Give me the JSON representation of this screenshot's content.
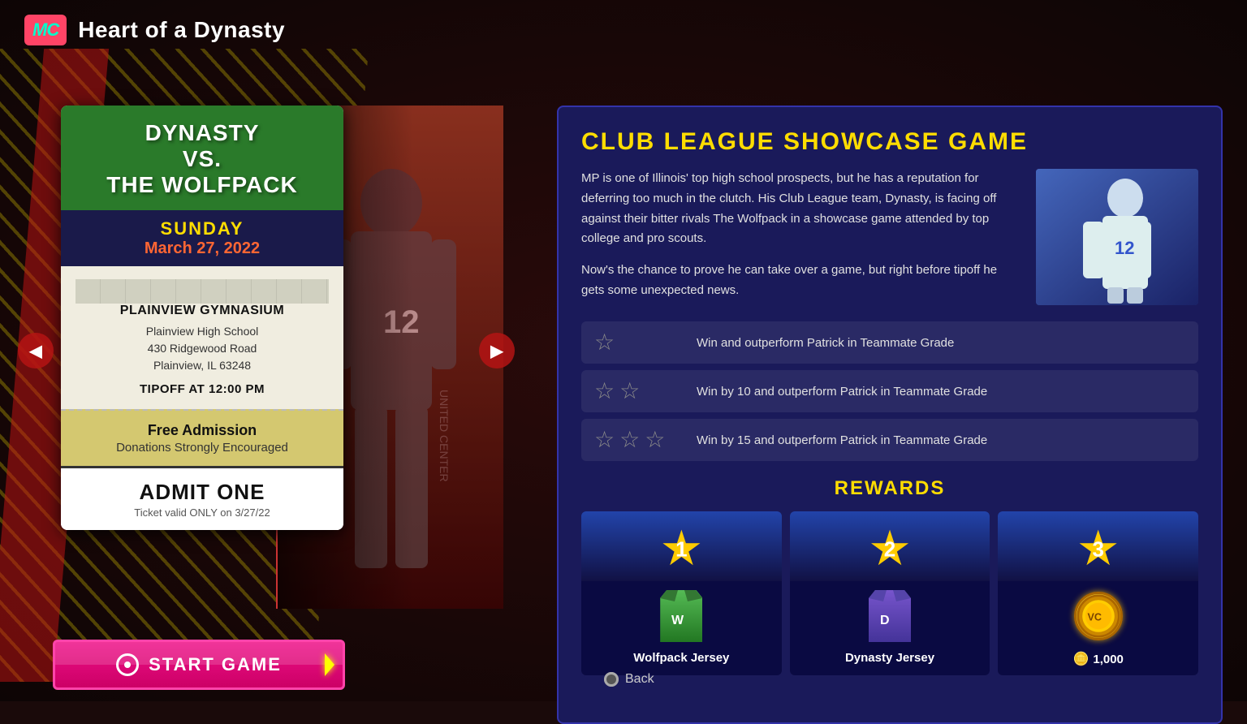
{
  "header": {
    "mc_label": "MC",
    "title": "Heart of a Dynasty"
  },
  "ticket": {
    "matchup_line1": "DYNASTY",
    "matchup_line2": "VS.",
    "matchup_line3": "THE WOLFPACK",
    "day": "SUNDAY",
    "date": "March 27, 2022",
    "venue": "PLAINVIEW GYMNASIUM",
    "address_line1": "Plainview High School",
    "address_line2": "430 Ridgewood Road",
    "address_line3": "Plainview, IL 63248",
    "tipoff": "TIPOFF AT 12:00 PM",
    "admission_main": "Free Admission",
    "admission_sub": "Donations Strongly Encouraged",
    "admit_main": "ADMIT ONE",
    "admit_sub": "Ticket valid ONLY on 3/27/22"
  },
  "start_button": {
    "label": "START GAME"
  },
  "showcase": {
    "title": "CLUB LEAGUE SHOWCASE GAME",
    "description_p1": "MP is one of Illinois' top high school prospects, but he has a reputation for deferring too much in the clutch. His Club League team, Dynasty, is facing off against their bitter rivals The Wolfpack in a showcase game attended by top college and pro scouts.",
    "description_p2": "Now's the chance to prove he can take over a game, but right before tipoff he gets some unexpected news.",
    "player_number": "12",
    "objectives": [
      {
        "stars": 1,
        "text": "Win and outperform Patrick in Teammate Grade"
      },
      {
        "stars": 2,
        "text": "Win by 10 and outperform Patrick in Teammate Grade"
      },
      {
        "stars": 3,
        "text": "Win by 15 and outperform Patrick in Teammate Grade"
      }
    ],
    "rewards_title": "REWARDS",
    "rewards": [
      {
        "tier": 1,
        "label": "Wolfpack Jersey",
        "type": "jersey_wolfpack"
      },
      {
        "tier": 2,
        "label": "Dynasty Jersey",
        "type": "jersey_dynasty"
      },
      {
        "tier": 3,
        "label": "1,000",
        "type": "coins"
      }
    ]
  },
  "back_button": {
    "label": "Back"
  },
  "colors": {
    "accent_yellow": "#ffdd00",
    "accent_pink": "#ee1188",
    "dark_bg": "#1a0a0a",
    "info_bg": "#1a1a5a"
  }
}
